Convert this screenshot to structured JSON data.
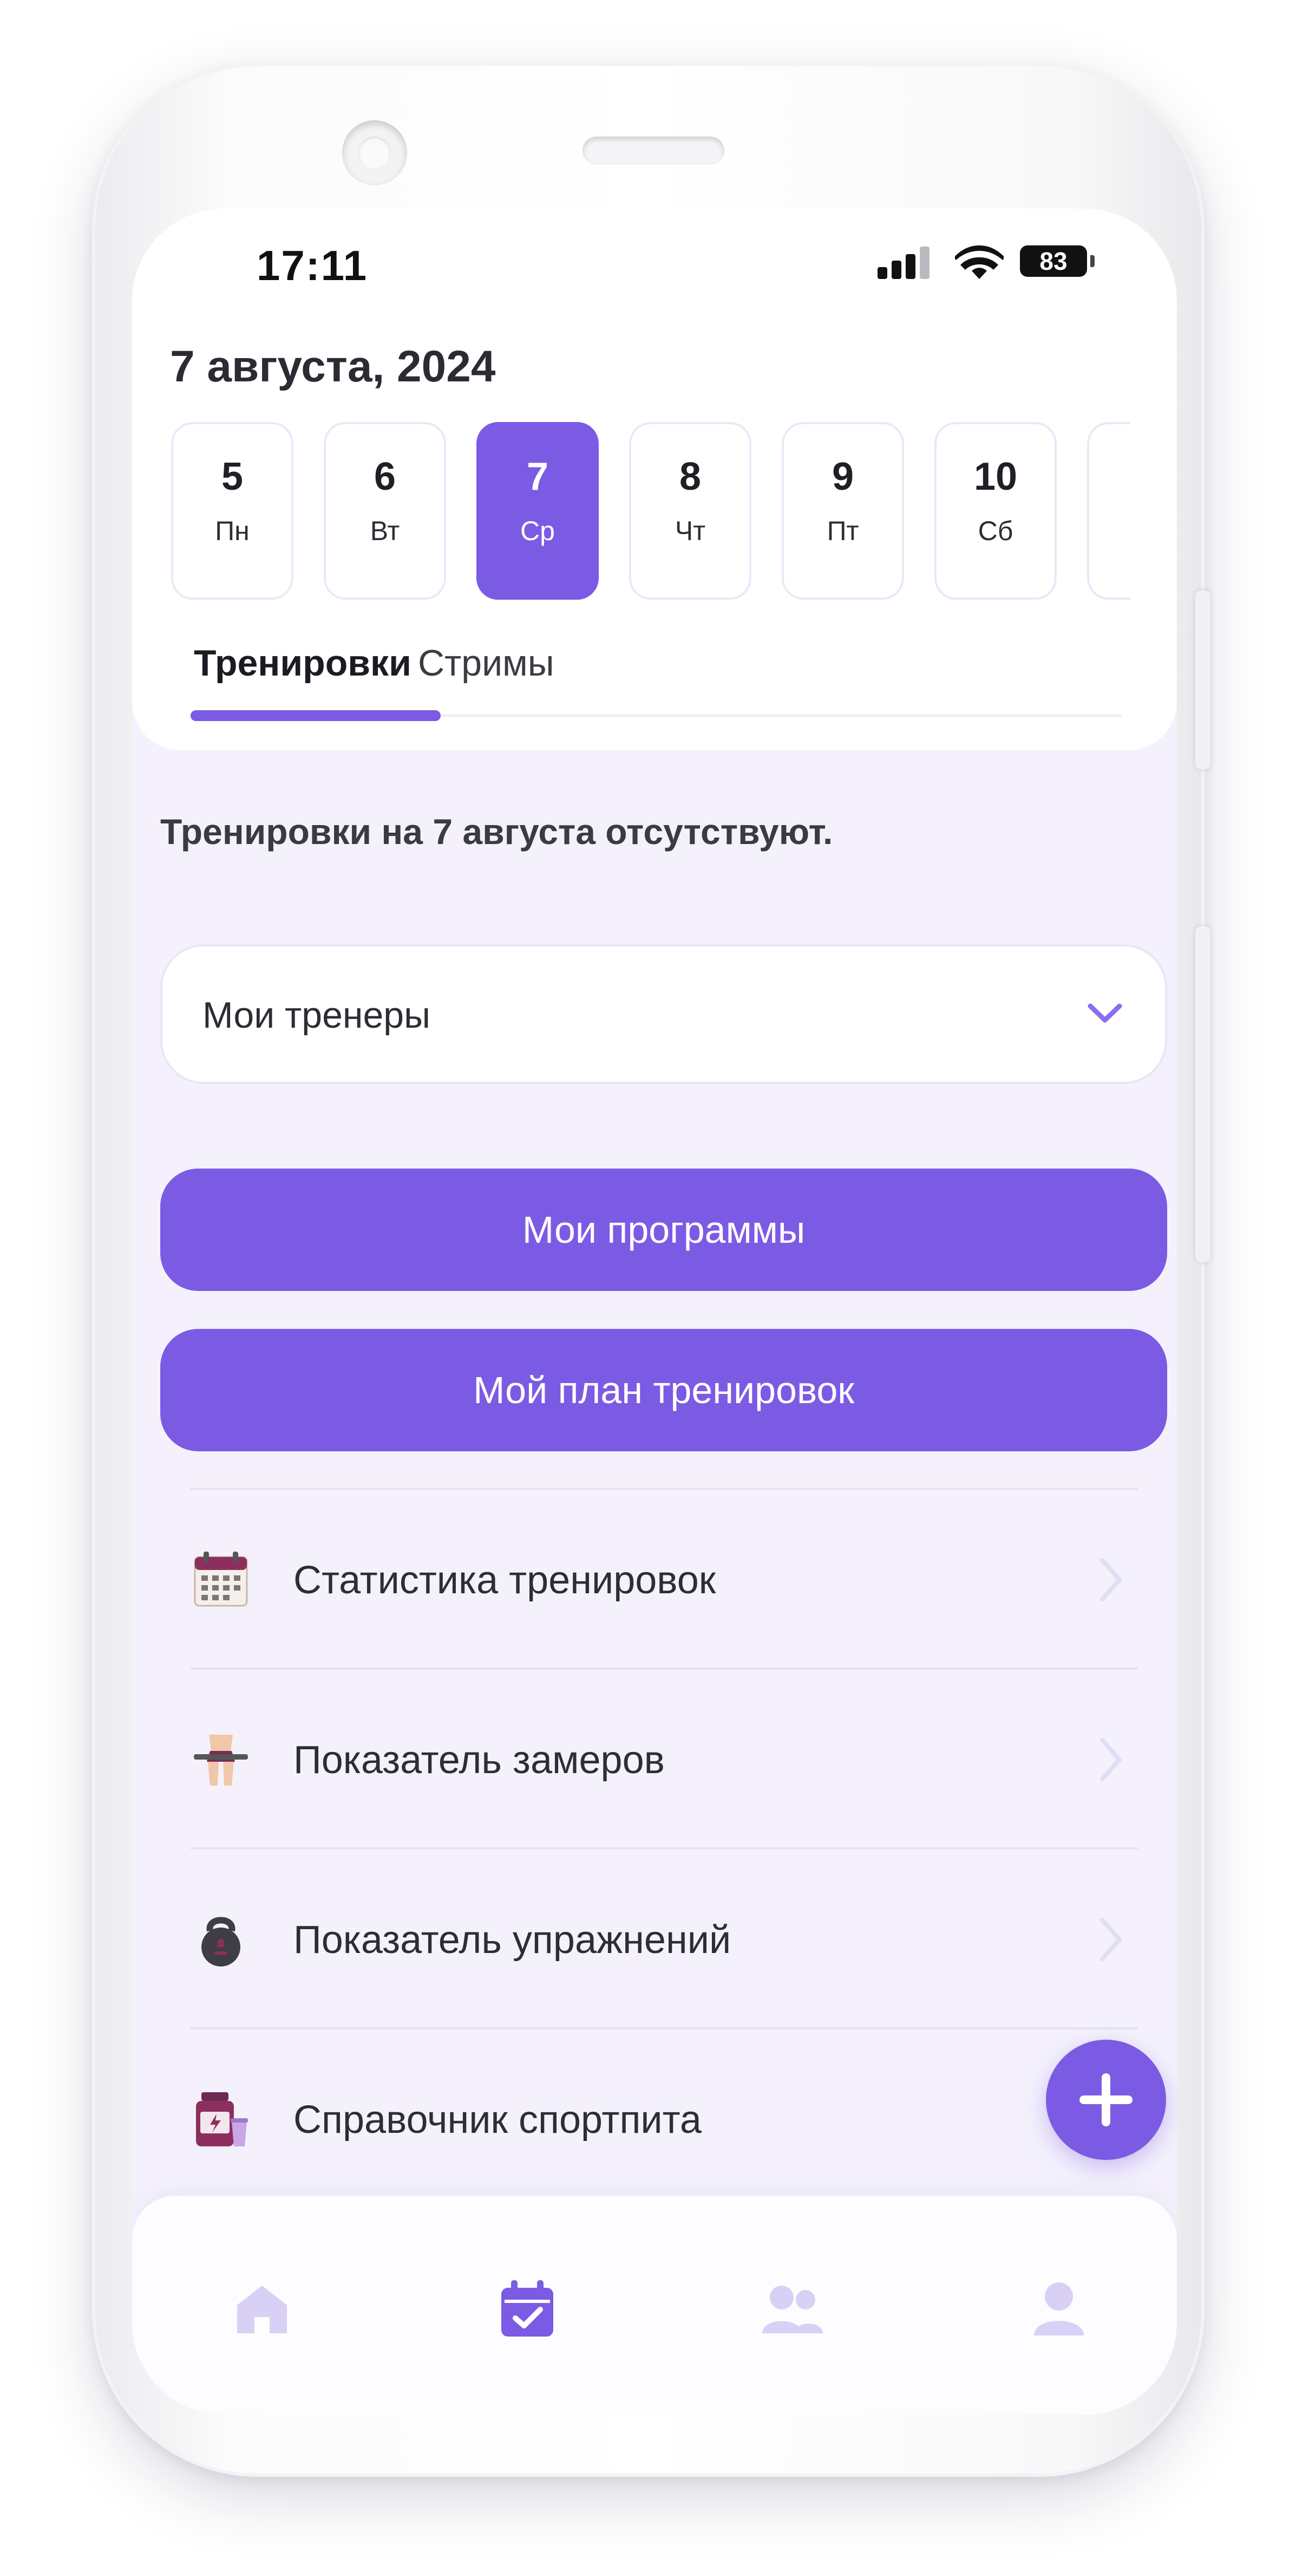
{
  "status_bar": {
    "time": "17:11",
    "battery": "83"
  },
  "header": {
    "date_title": "7 августа, 2024"
  },
  "days": [
    {
      "num": "5",
      "weekday": "Пн"
    },
    {
      "num": "6",
      "weekday": "Вт"
    },
    {
      "num": "7",
      "weekday": "Ср"
    },
    {
      "num": "8",
      "weekday": "Чт"
    },
    {
      "num": "9",
      "weekday": "Пт"
    },
    {
      "num": "10",
      "weekday": "Сб"
    }
  ],
  "selected_day_index": 2,
  "tabs": [
    {
      "label": "Тренировки"
    },
    {
      "label": "Стримы"
    }
  ],
  "active_tab_index": 0,
  "main": {
    "empty_message": "Тренировки на 7 августа отсутствуют.",
    "trainers_select": "Мои тренеры",
    "my_programs_button": "Мои программы",
    "my_plan_button": "Мой план тренировок"
  },
  "menu": [
    {
      "label": "Статистика тренировок",
      "icon": "calendar-stats-icon"
    },
    {
      "label": "Показатель замеров",
      "icon": "body-measure-icon"
    },
    {
      "label": "Показатель упражнений",
      "icon": "kettlebell-icon"
    },
    {
      "label": "Справочник спортпита",
      "icon": "supplement-jar-icon"
    }
  ],
  "bottom_nav": [
    "home-icon",
    "calendar-check-icon",
    "group-icon",
    "profile-icon"
  ],
  "colors": {
    "accent": "#7b5be4",
    "background": "#f4f1fc",
    "nav_inactive": "#d9d0f6"
  }
}
